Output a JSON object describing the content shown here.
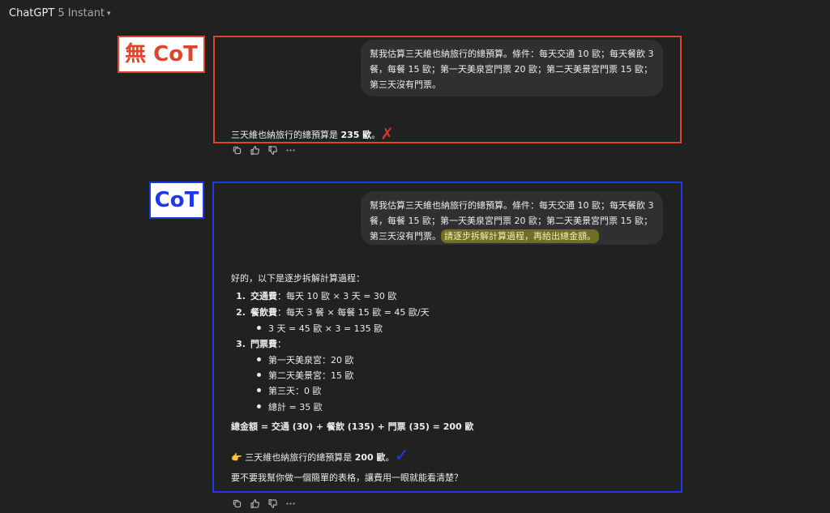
{
  "header": {
    "app_name": "ChatGPT",
    "model": "5 Instant"
  },
  "labels": {
    "no_cot": "無 CoT",
    "cot": "CoT"
  },
  "nocot": {
    "prompt_lines": [
      "幫我估算三天維也納旅行的總預算。條件：每天交通 10 歐；每天餐飲 3",
      "餐，每餐 15 歐；第一天美泉宮門票 20 歐；第二天美景宮門票 15 歐；",
      "第三天沒有門票。"
    ],
    "answer_prefix": "三天維也納旅行的總預算是 ",
    "answer_value": "235 歐",
    "answer_suffix": "。",
    "mark": "✗"
  },
  "cot": {
    "prompt_lines": [
      "幫我估算三天維也納旅行的總預算。條件：每天交通 10 歐；每天餐飲 3",
      "餐，每餐 15 歐；第一天美泉宮門票 20 歐；第二天美景宮門票 15 歐；",
      "第三天沒有門票。"
    ],
    "highlight": "請逐步拆解計算過程，再給出總金額。",
    "intro": "好的，以下是逐步拆解計算過程：",
    "step1_label": "交通費",
    "step1_text": "：每天 10 歐 × 3 天 = 30 歐",
    "step2_label": "餐飲費",
    "step2_text": "：每天 3 餐 × 每餐 15 歐 = 45 歐/天",
    "step2_sub": "3 天 = 45 歐 × 3 = 135 歐",
    "step3_label": "門票費",
    "step3_text": "：",
    "step3_items": [
      "第一天美泉宮：20 歐",
      "第二天美景宮：15 歐",
      "第三天：0 歐",
      "總計 = 35 歐"
    ],
    "total": "總金額 = 交通 (30) + 餐飲 (135) + 門票 (35) = 200 歐",
    "answer_emoji": "👉",
    "answer_prefix": "三天維也納旅行的總預算是 ",
    "answer_value": "200 歐",
    "answer_suffix": "。",
    "mark": "✓",
    "followup": "要不要我幫你做一個簡單的表格，讓費用一眼就能看清楚？"
  },
  "colors": {
    "no_cot": "#e0442b",
    "cot": "#1f39e8",
    "highlight": "#6f6e21"
  },
  "action_icons": [
    "copy-icon",
    "thumbs-up-icon",
    "thumbs-down-icon",
    "more-icon"
  ]
}
